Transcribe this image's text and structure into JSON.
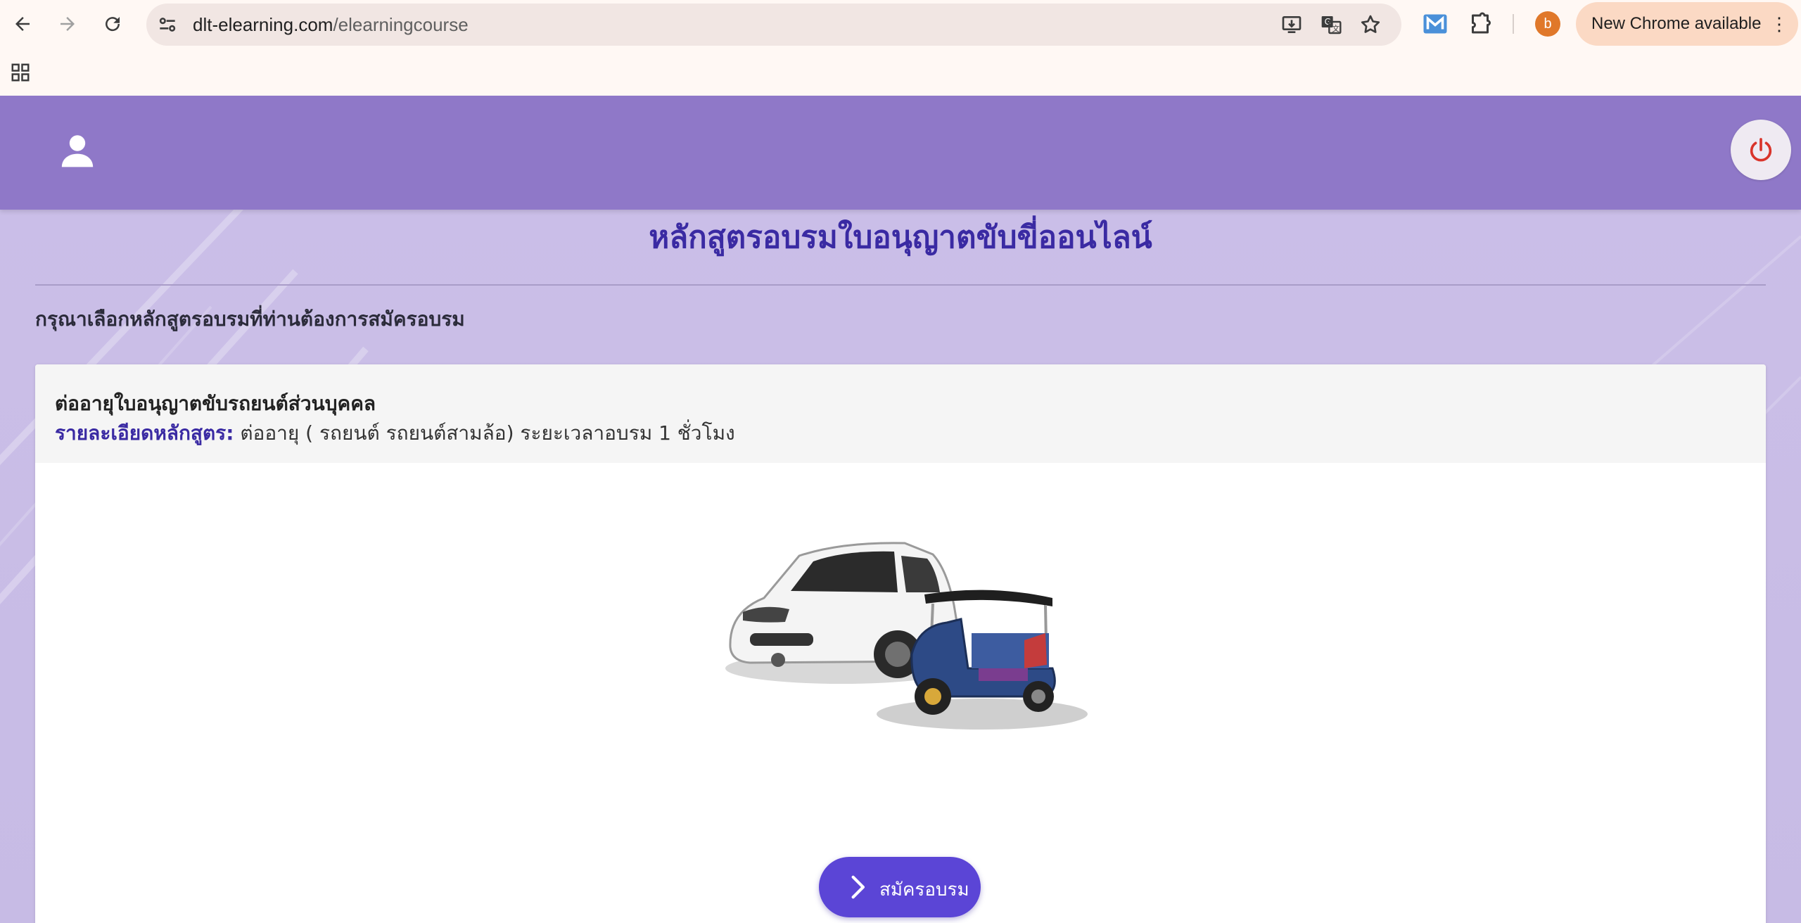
{
  "browser": {
    "url_host": "dlt-elearning.com",
    "url_path": "/elearningcourse",
    "avatar_letter": "b",
    "update_label": "New Chrome available",
    "update_menu": "⋮"
  },
  "page": {
    "title": "หลักสูตรอบรมใบอนุญาตขับขี่ออนไลน์",
    "instruction": "กรุณาเลือกหลักสูตรอบรมที่ท่านต้องการสมัครอบรม"
  },
  "course": {
    "name": "ต่ออายุใบอนุญาตขับรถยนต์ส่วนบุคคล",
    "detail_label": "รายละเอียดหลักสูตร:",
    "detail_text": " ต่ออายุ ( รถยนต์ รถยนต์สามล้อ) ระยะเวลาอบรม 1 ชั่วโมง",
    "enroll_label": "สมัครอบรม"
  },
  "colors": {
    "header": "#8f78c8",
    "title": "#3a2aa3",
    "button": "#5b45d6",
    "page_bg": "#c9bde6"
  },
  "icons": {
    "header_left": "user-icon",
    "header_right": "power-icon",
    "button": "chevron-right-icon"
  }
}
